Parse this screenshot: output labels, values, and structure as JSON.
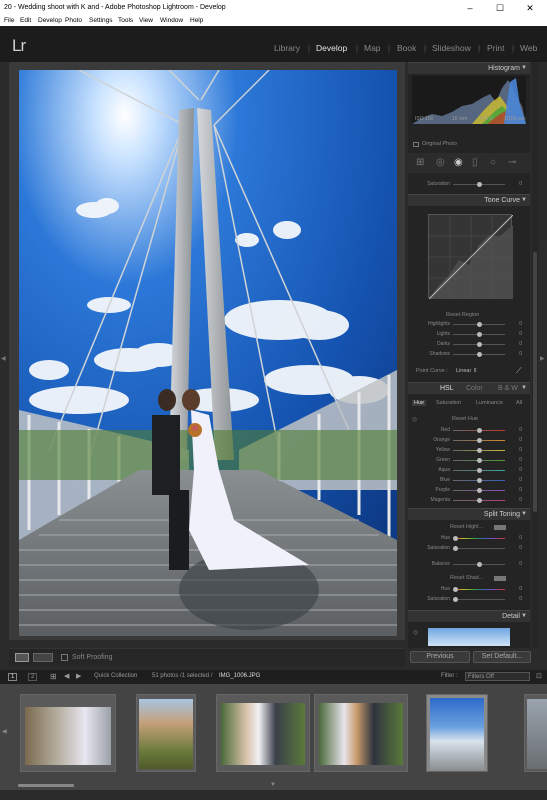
{
  "window": {
    "title": "20  - Wedding shoot with K  and  - Adobe Photoshop Lightroom - Develop",
    "minimize": "–",
    "maximize": "☐",
    "close": "✕"
  },
  "menu": [
    "File",
    "Edit",
    "Develop",
    "Photo",
    "Settings",
    "Tools",
    "View",
    "Window",
    "Help"
  ],
  "logo": "Lr",
  "modules": [
    "Library",
    "Develop",
    "Map",
    "Book",
    "Slideshow",
    "Print",
    "Web"
  ],
  "active_module": "Develop",
  "panel": {
    "histogram": {
      "title": "Histogram",
      "info": [
        "ISO 100",
        "16 mm",
        "f / 6.3",
        "1/160 sec"
      ],
      "original_photo": "Original Photo"
    },
    "saturation_top": {
      "label": "Saturation",
      "value": "0"
    },
    "tone_curve": {
      "title": "Tone Curve",
      "reset": "Reset Region",
      "sliders": [
        {
          "label": "Highlights",
          "value": "0",
          "pos": 0.5
        },
        {
          "label": "Lights",
          "value": "0",
          "pos": 0.5
        },
        {
          "label": "Darks",
          "value": "0",
          "pos": 0.5
        },
        {
          "label": "Shadows",
          "value": "0",
          "pos": 0.5
        }
      ],
      "point_curve_label": "Point Curve :",
      "point_curve_value": "Linear ⇕"
    },
    "hsl": {
      "tabs_header": [
        "HSL",
        "Color",
        "B & W"
      ],
      "subtabs": [
        "Hue",
        "Saturation",
        "Luminance",
        "All"
      ],
      "reset": "Reset Hue",
      "sliders": [
        {
          "label": "Red",
          "value": "0",
          "color": "#c0392b",
          "pos": 0.5
        },
        {
          "label": "Orange",
          "value": "0",
          "color": "#d58a2e",
          "pos": 0.5
        },
        {
          "label": "Yellow",
          "value": "0",
          "color": "#c9b833",
          "pos": 0.5
        },
        {
          "label": "Green",
          "value": "0",
          "color": "#4c9a3a",
          "pos": 0.5
        },
        {
          "label": "Aqua",
          "value": "0",
          "color": "#3aa3a3",
          "pos": 0.5
        },
        {
          "label": "Blue",
          "value": "0",
          "color": "#3a5fb8",
          "pos": 0.5
        },
        {
          "label": "Purple",
          "value": "0",
          "color": "#8a4ab5",
          "pos": 0.5
        },
        {
          "label": "Magenta",
          "value": "0",
          "color": "#b53a8a",
          "pos": 0.5
        }
      ]
    },
    "split_toning": {
      "title": "Split Toning",
      "highlights_reset": "Reset Highl...",
      "hue_label": "Hue",
      "hue_value": "0",
      "saturation_label": "Saturation",
      "saturation_value": "0",
      "balance_label": "Balance",
      "balance_value": "0",
      "shadows_reset": "Reset Shad...",
      "hue2_value": "0",
      "saturation2_value": "0"
    },
    "detail": {
      "title": "Detail"
    },
    "previous_button": "Previous",
    "set_default_button": "Set Default..."
  },
  "toolbar": {
    "soft_proofing": "Soft Proofing"
  },
  "filmstrip_bar": {
    "monitor1": "1",
    "monitor2": "2",
    "source": "Quick Collection",
    "count": "51 photos /1 selected /",
    "filename": "IMG_1006.JPG",
    "filter_label": "Filter :",
    "filter_value": "Filters Off"
  },
  "colors": {
    "accent_active": "#e6e6e6",
    "panel_bg": "#242424",
    "header_bg": "#1c1c1c"
  }
}
